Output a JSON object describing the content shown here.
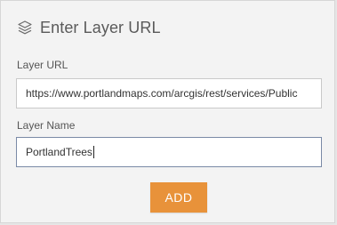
{
  "dialog": {
    "title": "Enter Layer URL",
    "title_icon": "layers-icon"
  },
  "layer_url": {
    "label": "Layer URL",
    "value": "https://www.portlandmaps.com/arcgis/rest/services/Public"
  },
  "layer_name": {
    "label": "Layer Name",
    "value": "PortlandTrees"
  },
  "add_button": {
    "label": "ADD"
  },
  "colors": {
    "accent": "#e8923a",
    "panel_bg": "#f3f3f3",
    "focused_border": "#7a8aa6"
  }
}
